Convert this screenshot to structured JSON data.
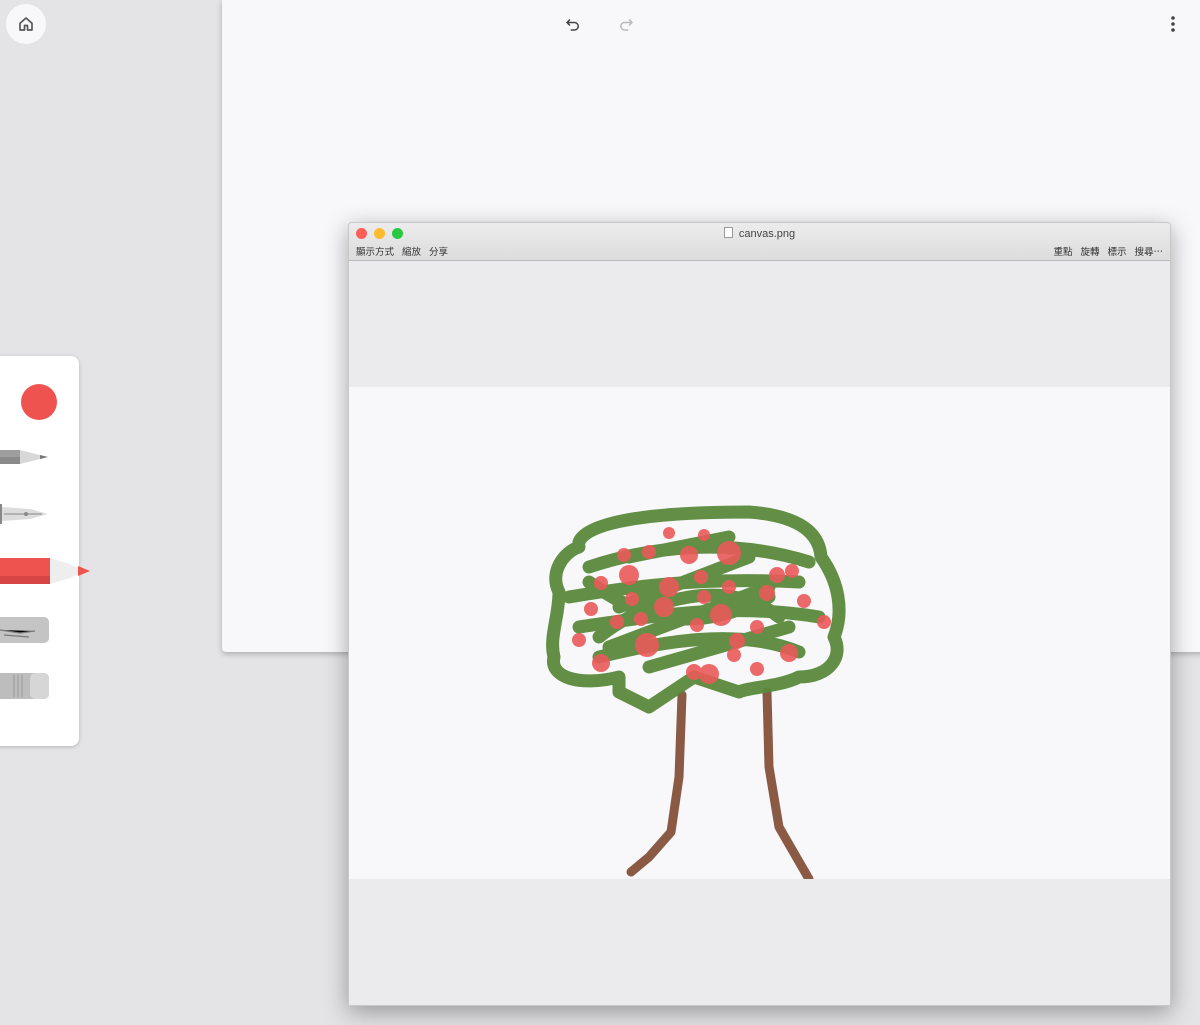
{
  "app": {
    "icons": [
      "home-icon",
      "undo-icon",
      "redo-icon",
      "more-vert-icon"
    ]
  },
  "tools": [
    {
      "name": "color-swatch",
      "color": "#ef5350"
    },
    {
      "name": "pencil"
    },
    {
      "name": "fountain-pen"
    },
    {
      "name": "marker",
      "selected": true,
      "color": "#ef5350"
    },
    {
      "name": "chalk"
    },
    {
      "name": "eraser"
    }
  ],
  "preview": {
    "title": "canvas.png",
    "menu_left": [
      "顯示方式",
      "縮放",
      "分享"
    ],
    "menu_right": [
      "重點",
      "旋轉",
      "標示",
      "搜尋⋯"
    ]
  },
  "colors": {
    "accent": "#ef5350",
    "leaves": "#5a8a3c",
    "trunk": "#8a5a44",
    "fruit": "#ea5a5a"
  }
}
